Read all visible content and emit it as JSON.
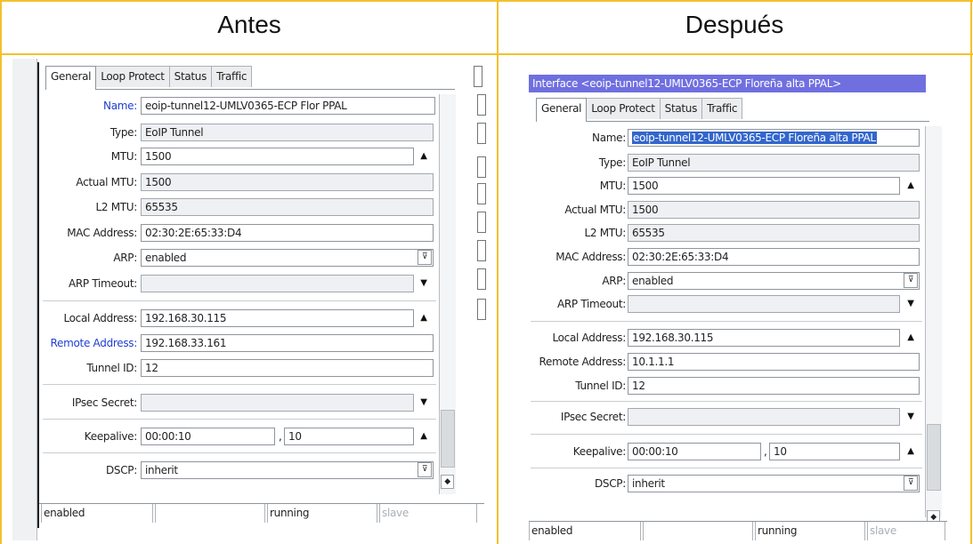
{
  "headers": {
    "before": "Antes",
    "after": "Después"
  },
  "colors": {
    "frame": "#f2c12e",
    "titlebar": "#6f6fe0",
    "label_highlight": "#1f3fcf",
    "selection": "#3366cc"
  },
  "before": {
    "tabs": [
      "General",
      "Loop Protect",
      "Status",
      "Traffic"
    ],
    "fields": {
      "name": {
        "label": "Name:",
        "value": "eoip-tunnel12-UMLV0365-ECP Flor PPAL"
      },
      "type": {
        "label": "Type:",
        "value": "EoIP Tunnel"
      },
      "mtu": {
        "label": "MTU:",
        "value": "1500"
      },
      "actual_mtu": {
        "label": "Actual MTU:",
        "value": "1500"
      },
      "l2_mtu": {
        "label": "L2 MTU:",
        "value": "65535"
      },
      "mac": {
        "label": "MAC Address:",
        "value": "02:30:2E:65:33:D4"
      },
      "arp": {
        "label": "ARP:",
        "value": "enabled"
      },
      "arp_timeout": {
        "label": "ARP Timeout:",
        "value": ""
      },
      "local_address": {
        "label": "Local Address:",
        "value": "192.168.30.115"
      },
      "remote_address": {
        "label": "Remote Address:",
        "value": "192.168.33.161"
      },
      "tunnel_id": {
        "label": "Tunnel ID:",
        "value": "12"
      },
      "ipsec_secret": {
        "label": "IPsec Secret:",
        "value": ""
      },
      "keepalive": {
        "label": "Keepalive:",
        "value": "00:00:10",
        "retries": "10"
      },
      "dscp": {
        "label": "DSCP:",
        "value": "inherit"
      }
    },
    "status": [
      "enabled",
      "",
      "running",
      "slave"
    ]
  },
  "after": {
    "title": "Interface <eoip-tunnel12-UMLV0365-ECP Floreña alta PPAL>",
    "tabs": [
      "General",
      "Loop Protect",
      "Status",
      "Traffic"
    ],
    "fields": {
      "name": {
        "label": "Name:",
        "value": "eoip-tunnel12-UMLV0365-ECP Floreña alta PPAL"
      },
      "type": {
        "label": "Type:",
        "value": "EoIP Tunnel"
      },
      "mtu": {
        "label": "MTU:",
        "value": "1500"
      },
      "actual_mtu": {
        "label": "Actual MTU:",
        "value": "1500"
      },
      "l2_mtu": {
        "label": "L2 MTU:",
        "value": "65535"
      },
      "mac": {
        "label": "MAC Address:",
        "value": "02:30:2E:65:33:D4"
      },
      "arp": {
        "label": "ARP:",
        "value": "enabled"
      },
      "arp_timeout": {
        "label": "ARP Timeout:",
        "value": ""
      },
      "local_address": {
        "label": "Local Address:",
        "value": "192.168.30.115"
      },
      "remote_address": {
        "label": "Remote Address:",
        "value": "10.1.1.1"
      },
      "tunnel_id": {
        "label": "Tunnel ID:",
        "value": "12"
      },
      "ipsec_secret": {
        "label": "IPsec Secret:",
        "value": ""
      },
      "keepalive": {
        "label": "Keepalive:",
        "value": "00:00:10",
        "retries": "10"
      },
      "dscp": {
        "label": "DSCP:",
        "value": "inherit"
      }
    },
    "status": [
      "enabled",
      "",
      "running",
      "slave"
    ]
  },
  "icons": {
    "stepper_up": "▲",
    "dropdown_down": "▼",
    "combo_down": "⊽",
    "spin_updown": "◆"
  }
}
